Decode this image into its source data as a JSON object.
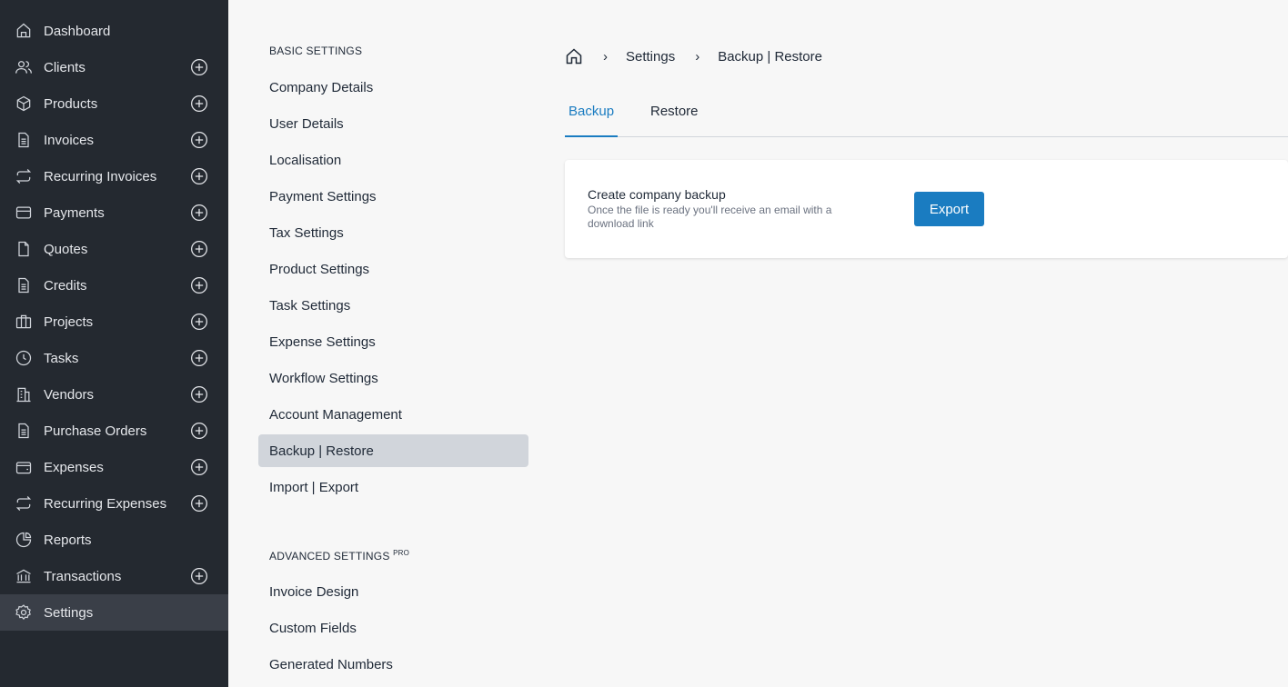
{
  "sidebar": {
    "items": [
      {
        "label": "Dashboard",
        "icon": "home-icon",
        "plus": false
      },
      {
        "label": "Clients",
        "icon": "users-icon",
        "plus": true
      },
      {
        "label": "Products",
        "icon": "box-icon",
        "plus": true
      },
      {
        "label": "Invoices",
        "icon": "file-text-icon",
        "plus": true
      },
      {
        "label": "Recurring Invoices",
        "icon": "repeat-icon",
        "plus": true
      },
      {
        "label": "Payments",
        "icon": "credit-card-icon",
        "plus": true
      },
      {
        "label": "Quotes",
        "icon": "file-icon",
        "plus": true
      },
      {
        "label": "Credits",
        "icon": "file-text-icon",
        "plus": true
      },
      {
        "label": "Projects",
        "icon": "briefcase-icon",
        "plus": true
      },
      {
        "label": "Tasks",
        "icon": "clock-icon",
        "plus": true
      },
      {
        "label": "Vendors",
        "icon": "building-icon",
        "plus": true
      },
      {
        "label": "Purchase Orders",
        "icon": "file-text-icon",
        "plus": true
      },
      {
        "label": "Expenses",
        "icon": "wallet-icon",
        "plus": true
      },
      {
        "label": "Recurring Expenses",
        "icon": "repeat-icon",
        "plus": true
      },
      {
        "label": "Reports",
        "icon": "pie-chart-icon",
        "plus": false
      },
      {
        "label": "Transactions",
        "icon": "bank-icon",
        "plus": true
      },
      {
        "label": "Settings",
        "icon": "gear-icon",
        "plus": false,
        "active": true
      }
    ]
  },
  "settings_nav": {
    "basic_title": "BASIC SETTINGS",
    "basic": [
      "Company Details",
      "User Details",
      "Localisation",
      "Payment Settings",
      "Tax Settings",
      "Product Settings",
      "Task Settings",
      "Expense Settings",
      "Workflow Settings",
      "Account Management",
      "Backup | Restore",
      "Import | Export"
    ],
    "active": "Backup | Restore",
    "advanced_title": "ADVANCED SETTINGS",
    "advanced_badge": "PRO",
    "advanced": [
      "Invoice Design",
      "Custom Fields",
      "Generated Numbers"
    ]
  },
  "breadcrumb": [
    "Settings",
    "Backup | Restore"
  ],
  "tabs": {
    "backup": "Backup",
    "restore": "Restore"
  },
  "card": {
    "title": "Create company backup",
    "description": "Once the file is ready you'll receive an email with a download link",
    "button": "Export"
  },
  "colors": {
    "accent": "#1a7cc1",
    "sidebar": "#242930"
  }
}
